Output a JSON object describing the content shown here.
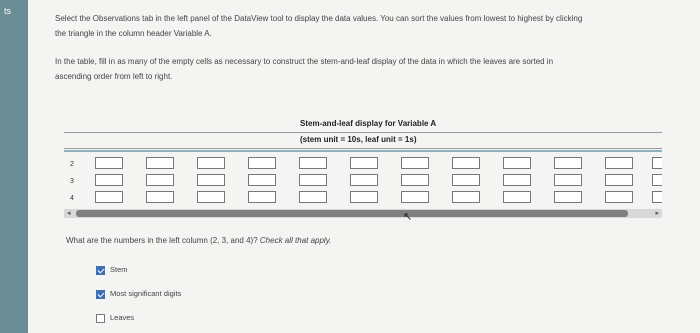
{
  "sidebar": {
    "label": "ts"
  },
  "instructions": {
    "p1a": "Select the Observations tab in the left panel of the DataView tool to display the data values. You can sort the values from lowest to highest by clicking",
    "p1b": "the triangle in the column header Variable A.",
    "p2a": "In the table, fill in as many of the empty cells as necessary to construct the stem-and-leaf display of the data in which the leaves are sorted in",
    "p2b": "ascending order from left to right."
  },
  "table": {
    "title": "Stem-and-leaf display for Variable A",
    "subtitle": "(stem unit = 10s, leaf unit = 1s)",
    "stems": [
      "2",
      "3",
      "4"
    ]
  },
  "question": {
    "text": "What are the numbers in the left column (2, 3, and 4)? ",
    "hint": "Check all that apply."
  },
  "options": [
    {
      "label": "Stem",
      "checked": true
    },
    {
      "label": "Most significant digits",
      "checked": true
    },
    {
      "label": "Leaves",
      "checked": false
    }
  ]
}
